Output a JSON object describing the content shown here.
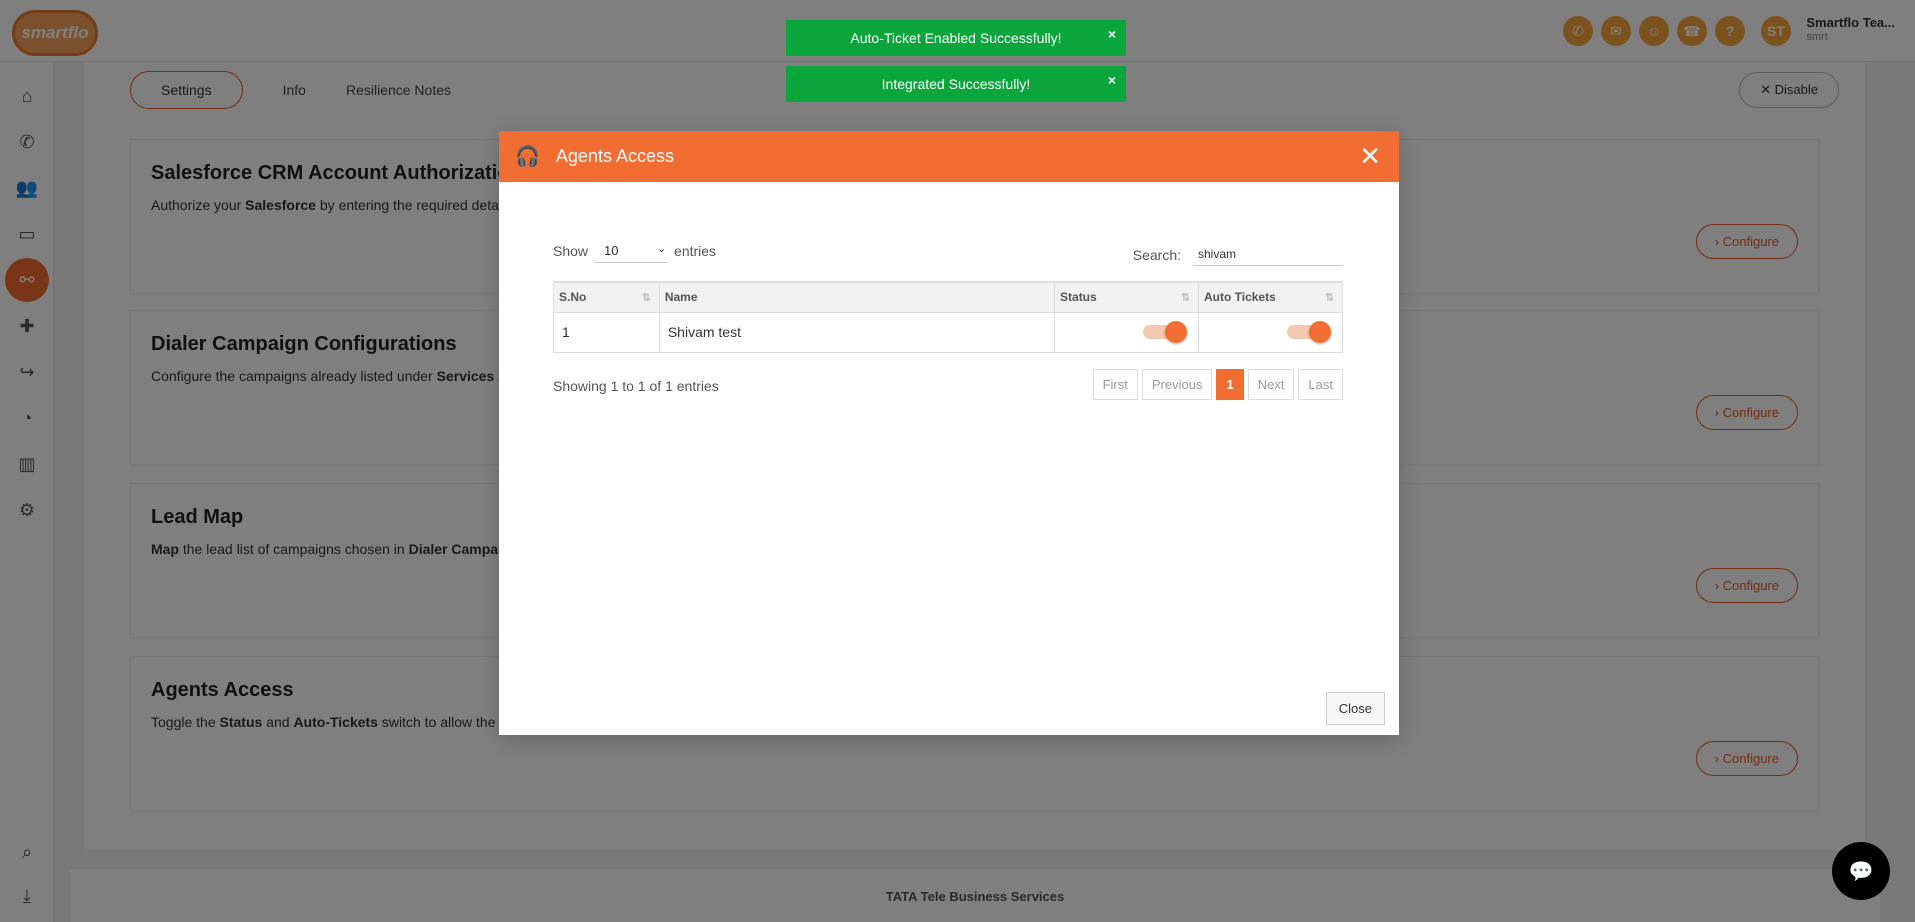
{
  "logo_text": "smartflo",
  "topbar": {
    "user_initials": "ST",
    "user_name": "Smartflo Tea...",
    "user_sub": "smrt"
  },
  "tabs": [
    "Settings",
    "Info",
    "Resilience Notes"
  ],
  "disable_label": "Disable",
  "cards": [
    {
      "title": "Salesforce CRM Account Authorization",
      "desc_pre": "Authorize your ",
      "desc_bold": "Salesforce",
      "desc_post": " by entering the required detail",
      "configure": "Configure"
    },
    {
      "title": "Dialer Campaign Configurations",
      "desc_pre": "Configure the campaigns already listed under ",
      "desc_bold": "Services >",
      "desc_post": "",
      "configure": "Configure"
    },
    {
      "title": "Lead Map",
      "desc_pre": "",
      "desc_bold": "Map",
      "desc_post": " the lead list of campaigns chosen in ",
      "desc_bold2": "Dialer Campaig",
      "configure": "Configure"
    },
    {
      "title": "Agents Access",
      "desc_pre": "Toggle the ",
      "desc_bold": "Status",
      "desc_post": " and ",
      "desc_bold2": "Auto-Tickets",
      "desc_post2": " switch to allow the t",
      "configure": "Configure"
    }
  ],
  "footer": "TATA Tele Business Services",
  "toasts": [
    {
      "text": "Auto-Ticket Enabled Successfully!",
      "close": "×"
    },
    {
      "text": "Integrated Successfully!",
      "close": "×"
    }
  ],
  "modal": {
    "title": "Agents Access",
    "close_x": "✕",
    "show_label": "Show",
    "entries_value": "10",
    "entries_label": "entries",
    "search_label": "Search:",
    "search_value": "shivam",
    "columns": [
      "S.No",
      "Name",
      "Status",
      "Auto Tickets"
    ],
    "rows": [
      {
        "sno": "1",
        "name": "Shivam test",
        "status": true,
        "auto_tickets": true
      }
    ],
    "info": "Showing 1 to 1 of 1 entries",
    "pager": [
      "First",
      "Previous",
      "1",
      "Next",
      "Last"
    ],
    "close_button": "Close"
  }
}
